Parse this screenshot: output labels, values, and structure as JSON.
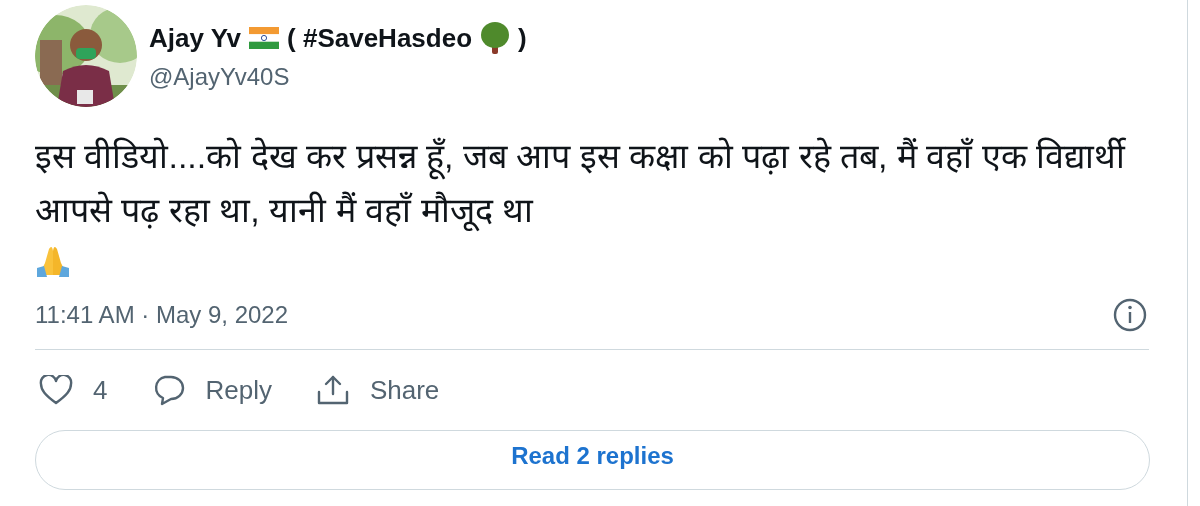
{
  "author": {
    "name": "Ajay Yv",
    "tag_open": "( #SaveHasdeo",
    "tag_close": ")",
    "handle": "@AjayYv40S"
  },
  "tweet": {
    "text": "इस वीडियो....को देख कर प्रसन्न हूँ, जब आप इस कक्षा को पढ़ा रहे तब, मैं वहाँ एक विद्यार्थी आपसे पढ़ रहा था, यानी मैं वहाँ मौजूद था",
    "timestamp": "11:41 AM · May 9, 2022"
  },
  "actions": [
    {
      "kind": "like",
      "label": "4"
    },
    {
      "kind": "reply",
      "label": "Reply"
    },
    {
      "kind": "share",
      "label": "Share"
    }
  ],
  "read_replies": "Read 2 replies"
}
